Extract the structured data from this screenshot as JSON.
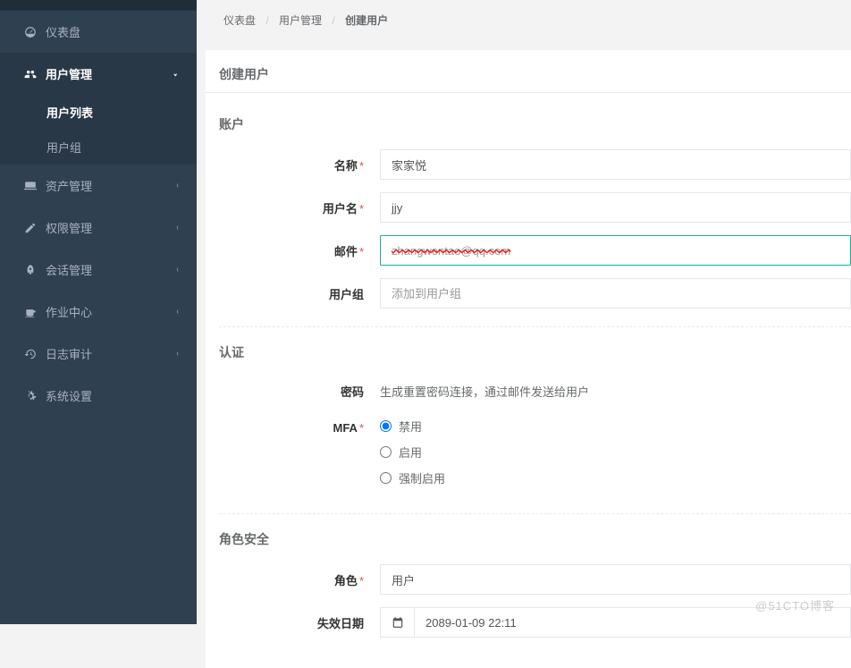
{
  "breadcrumb": {
    "items": [
      "仪表盘",
      "用户管理"
    ],
    "current": "创建用户"
  },
  "sidebar": {
    "dashboard": "仪表盘",
    "user_mgmt": "用户管理",
    "user_list": "用户列表",
    "user_group": "用户组",
    "asset_mgmt": "资产管理",
    "perm_mgmt": "权限管理",
    "session_mgmt": "会话管理",
    "job_center": "作业中心",
    "audit": "日志审计",
    "settings": "系统设置"
  },
  "panel": {
    "title": "创建用户",
    "account_section": "账户",
    "auth_section": "认证",
    "role_section": "角色安全",
    "labels": {
      "name": "名称",
      "username": "用户名",
      "email": "邮件",
      "usergroup": "用户组",
      "password": "密码",
      "mfa": "MFA",
      "role": "角色",
      "expire": "失效日期"
    },
    "values": {
      "name": "家家悦",
      "username": "jjy",
      "email": "zhangwentao@qq.com",
      "usergroup_placeholder": "添加到用户组",
      "password_hint": "生成重置密码连接，通过邮件发送给用户",
      "role": "用户",
      "expire": "2089-01-09 22:11"
    },
    "mfa_options": {
      "disabled": "禁用",
      "enabled": "启用",
      "force": "强制启用"
    }
  },
  "watermark": "@51CTO博客"
}
